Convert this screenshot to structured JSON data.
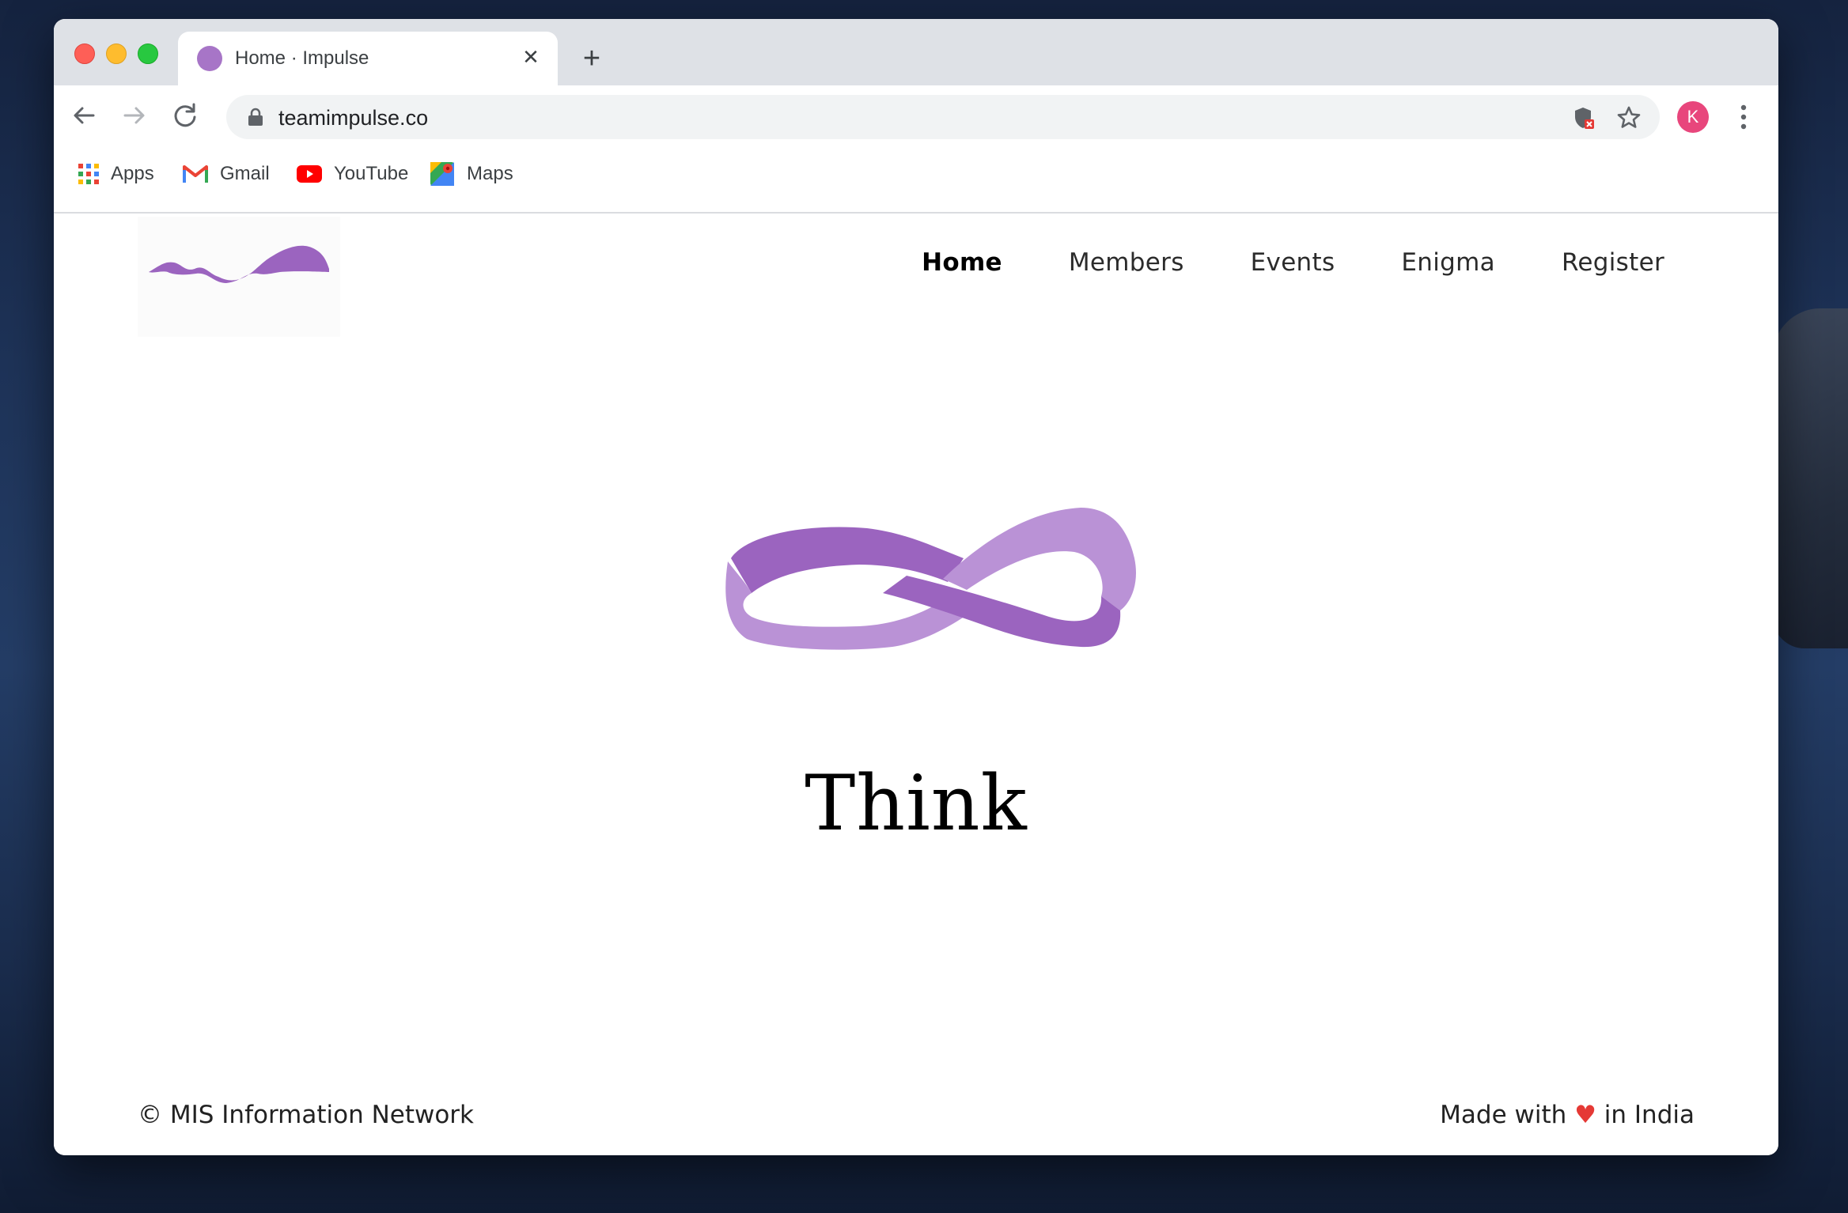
{
  "browser": {
    "tab": {
      "title": "Home · Impulse",
      "close_glyph": "✕"
    },
    "new_tab_glyph": "+",
    "address": {
      "url": "teamimpulse.co"
    },
    "profile": {
      "initial": "K",
      "color": "#e8467c"
    },
    "bookmarks": [
      {
        "label": "Apps",
        "icon": "apps-grid-icon"
      },
      {
        "label": "Gmail",
        "icon": "gmail-icon"
      },
      {
        "label": "YouTube",
        "icon": "youtube-icon"
      },
      {
        "label": "Maps",
        "icon": "maps-icon"
      }
    ]
  },
  "site": {
    "accent": "#9b64bf",
    "nav": [
      {
        "label": "Home",
        "active": true
      },
      {
        "label": "Members"
      },
      {
        "label": "Events"
      },
      {
        "label": "Enigma"
      },
      {
        "label": "Register"
      }
    ],
    "hero": {
      "word": "Think"
    },
    "footer": {
      "left": "© MIS Information Network",
      "right_prefix": "Made with",
      "heart": "♥",
      "right_suffix": "in India"
    }
  }
}
